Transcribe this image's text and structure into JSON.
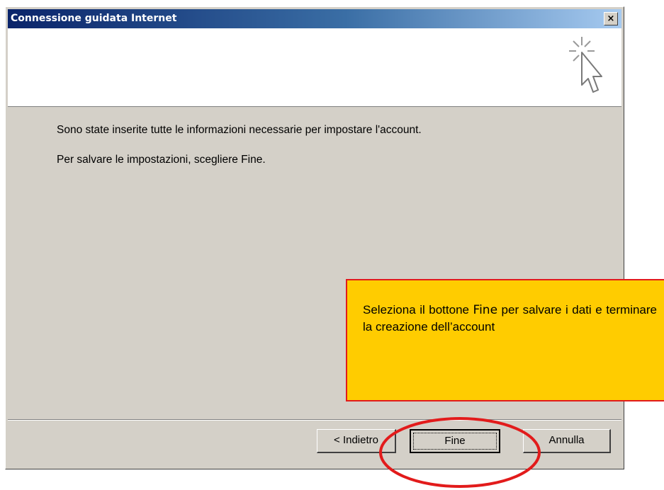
{
  "window": {
    "title": "Connessione guidata Internet",
    "close_glyph": "×"
  },
  "header": {
    "icon": "wizard-cursor-icon"
  },
  "content": {
    "line1": "Sono state inserite tutte le informazioni necessarie per impostare l'account.",
    "line2": "Per salvare le impostazioni, scegliere Fine."
  },
  "buttons": {
    "back": "< Indietro",
    "finish": "Fine",
    "cancel": "Annulla"
  },
  "callout": {
    "text_before": "Seleziona il bottone ",
    "text_strong": "Fine",
    "text_after": " per salvare i dati e terminare la creazione dell’account"
  },
  "colors": {
    "callout_bg": "#ffcc00",
    "callout_border": "#e21b1b",
    "title_bar": "#0a246a",
    "dialog_bg": "#d4d0c8"
  }
}
